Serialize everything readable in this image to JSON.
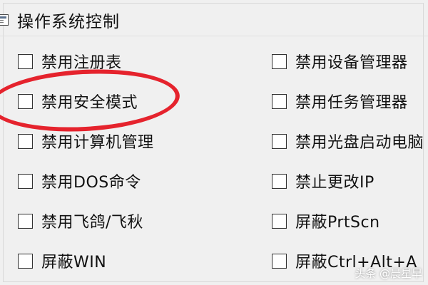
{
  "header": {
    "icon": "window-icon",
    "title": "操作系统控制"
  },
  "options_left": [
    {
      "label": "禁用注册表",
      "checked": false
    },
    {
      "label": "禁用安全模式",
      "checked": false,
      "highlighted": true
    },
    {
      "label": "禁用计算机管理",
      "checked": false
    },
    {
      "label": "禁用DOS命令",
      "checked": false
    },
    {
      "label": "禁用飞鸽/飞秋",
      "checked": false
    },
    {
      "label": "屏蔽WIN",
      "checked": false
    }
  ],
  "options_right": [
    {
      "label": "禁用设备管理器",
      "checked": false
    },
    {
      "label": "禁用任务管理器",
      "checked": false
    },
    {
      "label": "禁用光盘启动电脑",
      "checked": false
    },
    {
      "label": "禁止更改IP",
      "checked": false
    },
    {
      "label": "屏蔽PrtScn",
      "checked": false
    },
    {
      "label": "屏蔽Ctrl+Alt+A",
      "checked": false
    }
  ],
  "annotation": {
    "color": "#e5232d"
  },
  "watermark": "头条 @晨星早"
}
